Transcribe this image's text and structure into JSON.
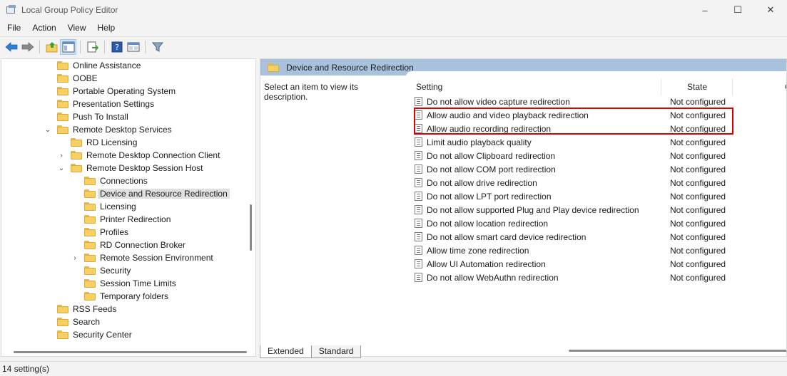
{
  "window": {
    "title": "Local Group Policy Editor",
    "controls": {
      "minimize": "–",
      "maximize": "☐",
      "close": "✕"
    }
  },
  "menu": [
    "File",
    "Action",
    "View",
    "Help"
  ],
  "toolbar": {
    "buttons": [
      "back-arrow-icon",
      "forward-arrow-icon",
      "up-folder-icon",
      "show-hide-tree-icon",
      "export-list-icon",
      "help-icon",
      "properties-icon",
      "filter-icon"
    ]
  },
  "tree": {
    "items": [
      {
        "label": "Online Assistance",
        "level": 1,
        "expander": ""
      },
      {
        "label": "OOBE",
        "level": 1,
        "expander": ""
      },
      {
        "label": "Portable Operating System",
        "level": 1,
        "expander": ""
      },
      {
        "label": "Presentation Settings",
        "level": 1,
        "expander": ""
      },
      {
        "label": "Push To Install",
        "level": 1,
        "expander": ""
      },
      {
        "label": "Remote Desktop Services",
        "level": 1,
        "expander": "expanded"
      },
      {
        "label": "RD Licensing",
        "level": 2,
        "expander": ""
      },
      {
        "label": "Remote Desktop Connection Client",
        "level": 2,
        "expander": "collapsed"
      },
      {
        "label": "Remote Desktop Session Host",
        "level": 2,
        "expander": "expanded"
      },
      {
        "label": "Connections",
        "level": 3,
        "expander": ""
      },
      {
        "label": "Device and Resource Redirection",
        "level": 3,
        "expander": "",
        "selected": true
      },
      {
        "label": "Licensing",
        "level": 3,
        "expander": ""
      },
      {
        "label": "Printer Redirection",
        "level": 3,
        "expander": ""
      },
      {
        "label": "Profiles",
        "level": 3,
        "expander": ""
      },
      {
        "label": "RD Connection Broker",
        "level": 3,
        "expander": ""
      },
      {
        "label": "Remote Session Environment",
        "level": 3,
        "expander": "collapsed"
      },
      {
        "label": "Security",
        "level": 3,
        "expander": ""
      },
      {
        "label": "Session Time Limits",
        "level": 3,
        "expander": ""
      },
      {
        "label": "Temporary folders",
        "level": 3,
        "expander": ""
      },
      {
        "label": "RSS Feeds",
        "level": 1,
        "expander": ""
      },
      {
        "label": "Search",
        "level": 1,
        "expander": ""
      },
      {
        "label": "Security Center",
        "level": 1,
        "expander": ""
      }
    ]
  },
  "right": {
    "header": "Device and Resource Redirection",
    "description": "Select an item to view its description.",
    "columns": {
      "setting": "Setting",
      "state": "State",
      "comment": "C"
    },
    "rows": [
      {
        "setting": "Do not allow video capture redirection",
        "state": "Not configured"
      },
      {
        "setting": "Allow audio and video playback redirection",
        "state": "Not configured"
      },
      {
        "setting": "Allow audio recording redirection",
        "state": "Not configured"
      },
      {
        "setting": "Limit audio playback quality",
        "state": "Not configured"
      },
      {
        "setting": "Do not allow Clipboard redirection",
        "state": "Not configured"
      },
      {
        "setting": "Do not allow COM port redirection",
        "state": "Not configured"
      },
      {
        "setting": "Do not allow drive redirection",
        "state": "Not configured"
      },
      {
        "setting": "Do not allow LPT port redirection",
        "state": "Not configured"
      },
      {
        "setting": "Do not allow supported Plug and Play device redirection",
        "state": "Not configured"
      },
      {
        "setting": "Do not allow location redirection",
        "state": "Not configured"
      },
      {
        "setting": "Do not allow smart card device redirection",
        "state": "Not configured"
      },
      {
        "setting": "Allow time zone redirection",
        "state": "Not configured"
      },
      {
        "setting": "Allow UI Automation redirection",
        "state": "Not configured"
      },
      {
        "setting": "Do not allow WebAuthn redirection",
        "state": "Not configured"
      }
    ]
  },
  "tabs": [
    "Extended",
    "Standard"
  ],
  "status": "14 setting(s)",
  "colors": {
    "highlight": "#e00000",
    "header": "#a8c2dd",
    "folder": "#f7d064"
  }
}
